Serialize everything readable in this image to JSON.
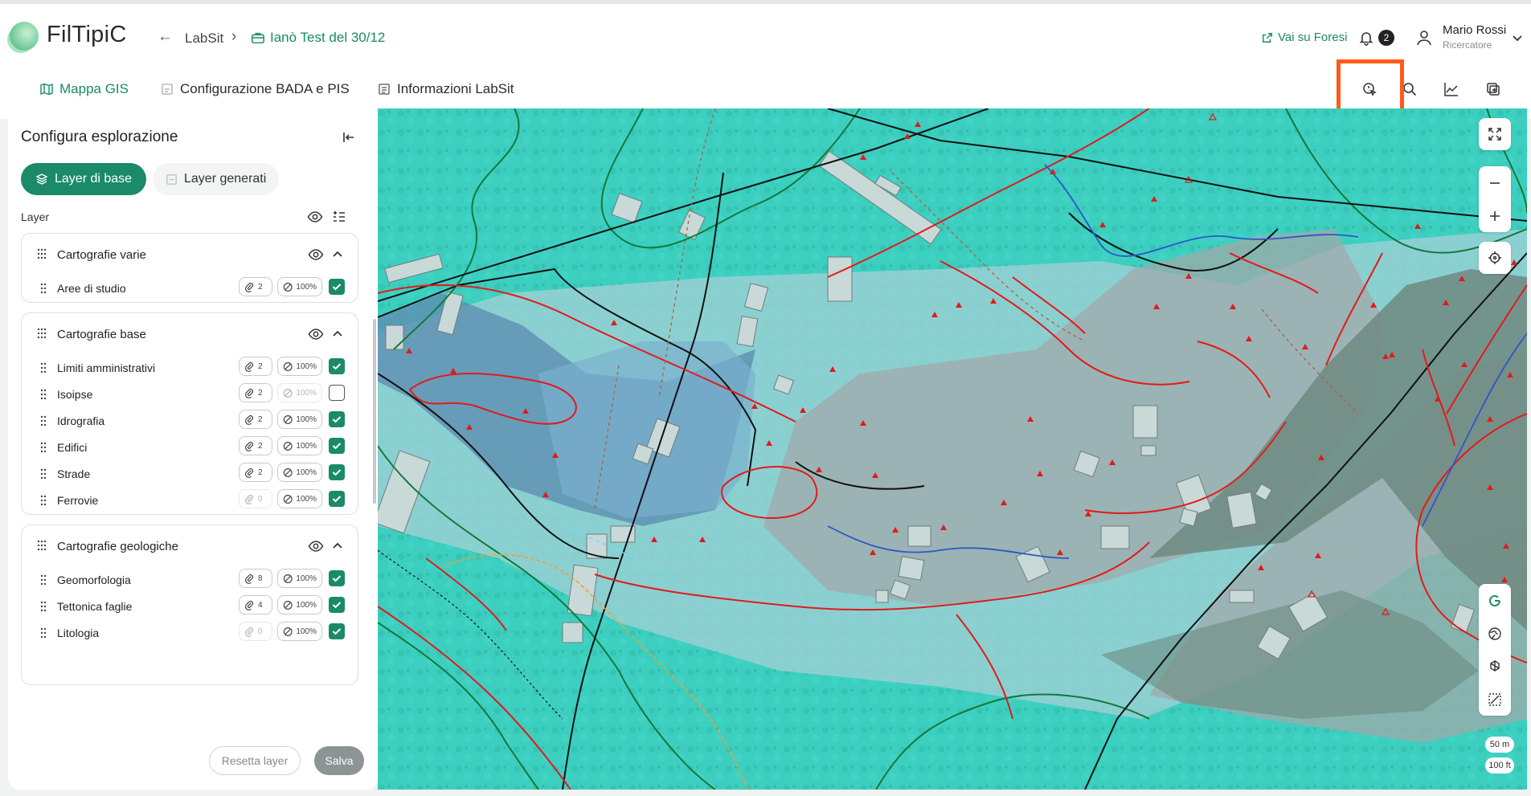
{
  "app": {
    "name": "FilTipiC",
    "breadcrumb": [
      "LabSit",
      "Ianò Test del 30/12"
    ]
  },
  "header": {
    "external_link": "Vai su Foresi",
    "notifications_count": "2",
    "user_name": "Mario Rossi",
    "user_role": "Ricercatore"
  },
  "tabs": [
    {
      "label": "Mappa GIS",
      "active": true
    },
    {
      "label": "Configurazione BADA e PIS",
      "active": false
    },
    {
      "label": "Informazioni LabSit",
      "active": false
    }
  ],
  "toolbar": {
    "tools": [
      "identify-cursor-icon",
      "search-icon",
      "chart-icon",
      "layers-export-icon"
    ],
    "highlighted": "identify-cursor-icon"
  },
  "panel": {
    "title": "Configura esplorazione",
    "pill_base": "Layer di base",
    "pill_generated": "Layer generati",
    "layer_label": "Layer",
    "groups": [
      {
        "title": "Cartografie varie",
        "layers": [
          {
            "name": "Aree di studio",
            "count": "2",
            "opacity": "100%",
            "checked": true,
            "enabled": true
          }
        ]
      },
      {
        "title": "Cartografie base",
        "layers": [
          {
            "name": "Limiti amministrativi",
            "count": "2",
            "opacity": "100%",
            "checked": true,
            "enabled": true
          },
          {
            "name": "Isoipse",
            "count": "2",
            "opacity": "100%",
            "checked": false,
            "enabled": false
          },
          {
            "name": "Idrografia",
            "count": "2",
            "opacity": "100%",
            "checked": true,
            "enabled": true
          },
          {
            "name": "Edifici",
            "count": "2",
            "opacity": "100%",
            "checked": true,
            "enabled": true
          },
          {
            "name": "Strade",
            "count": "2",
            "opacity": "100%",
            "checked": true,
            "enabled": true
          },
          {
            "name": "Ferrovie",
            "count": "0",
            "opacity": "100%",
            "checked": true,
            "enabled": true
          }
        ]
      },
      {
        "title": "Cartografie geologiche",
        "layers": [
          {
            "name": "Geomorfologia",
            "count": "8",
            "opacity": "100%",
            "checked": true,
            "enabled": true
          },
          {
            "name": "Tettonica faglie",
            "count": "4",
            "opacity": "100%",
            "checked": true,
            "enabled": true
          },
          {
            "name": "Litologia",
            "count": "0",
            "opacity": "100%",
            "checked": true,
            "enabled": true
          }
        ]
      }
    ],
    "reset_label": "Resetta layer",
    "save_label": "Salva"
  },
  "map": {
    "scale_metric": "50 m",
    "scale_imperial": "100 ft"
  },
  "colors": {
    "accent": "#1a8a68",
    "highlight": "#ff5b1a",
    "map_base": "#3ccfc0"
  }
}
